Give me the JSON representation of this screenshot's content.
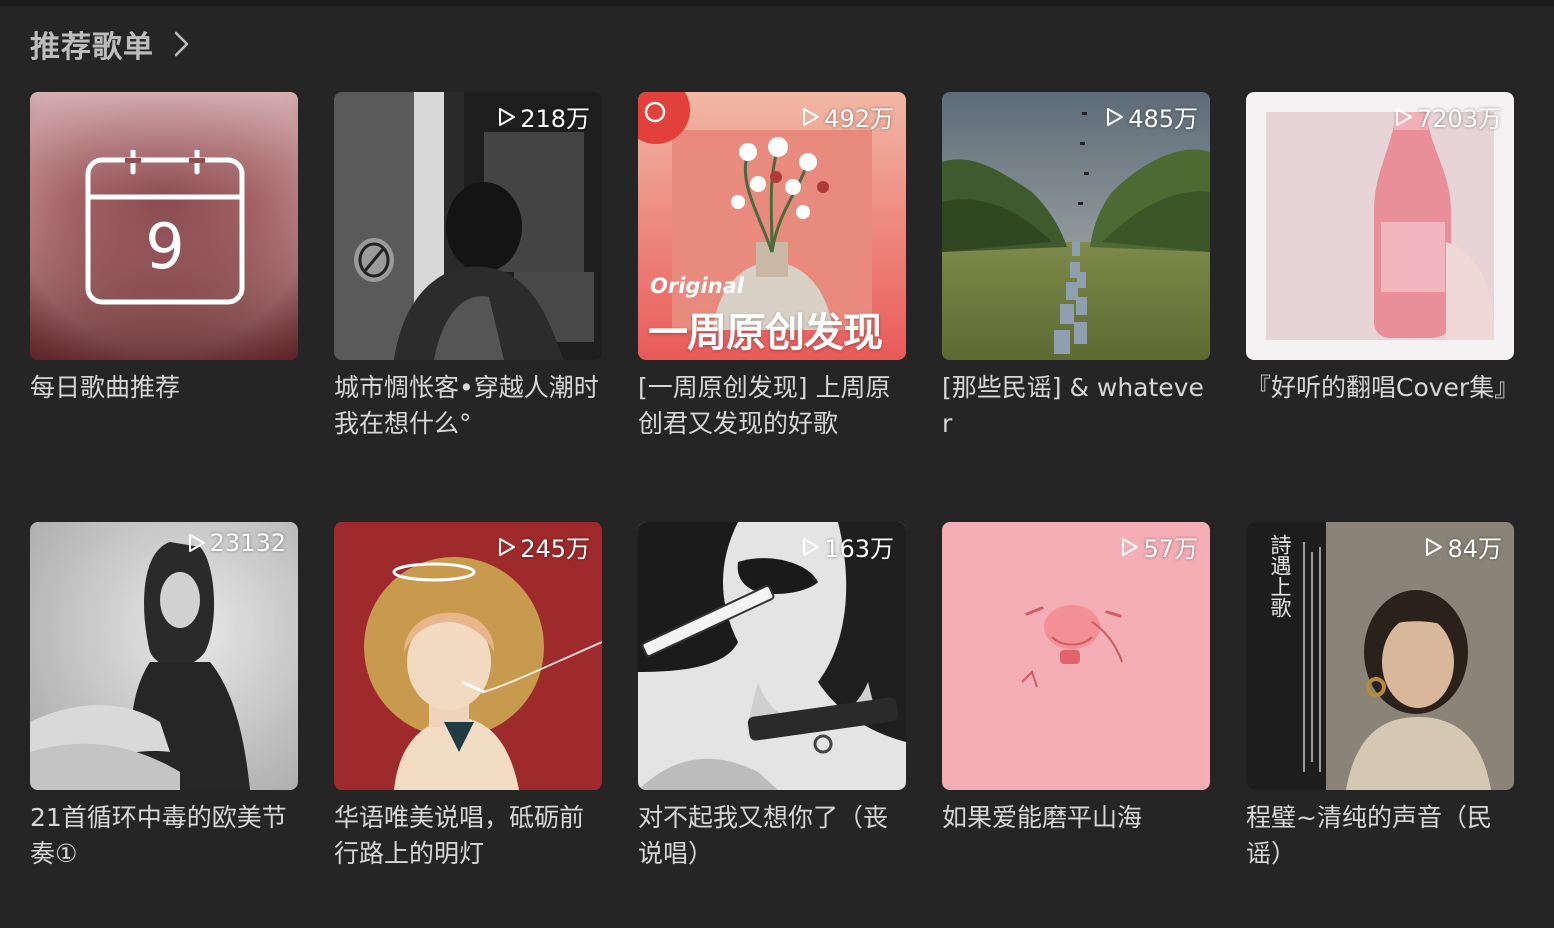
{
  "section": {
    "title": "推荐歌单"
  },
  "playlists": [
    {
      "title": "每日歌曲推荐",
      "plays": "",
      "calendar_day": "9"
    },
    {
      "title": "城市惆怅客•穿越人潮时我在想什么°",
      "plays": "218万"
    },
    {
      "title": "[一周原创发现] 上周原创君又发现的好歌",
      "plays": "492万",
      "cover_text_1": "Original",
      "cover_text_2": "一周原创发现"
    },
    {
      "title": " [那些民谣] & whatever",
      "plays": "485万"
    },
    {
      "title": "『好听的翻唱Cover集』",
      "plays": "7203万"
    },
    {
      "title": "21首循环中毒的欧美节奏①",
      "plays": "23132"
    },
    {
      "title": "华语唯美说唱，砥砺前行路上的明灯",
      "plays": "245万"
    },
    {
      "title": "对不起我又想你了（丧说唱）",
      "plays": "163万"
    },
    {
      "title": "如果爱能磨平山海",
      "plays": "57万"
    },
    {
      "title": "程璧~清纯的声音（民谣）",
      "plays": "84万",
      "cover_text_1": "詩遇上歌"
    }
  ],
  "colors": {
    "background": "#252525",
    "text": "#d6d6d6",
    "header": "#bdbdbd"
  }
}
